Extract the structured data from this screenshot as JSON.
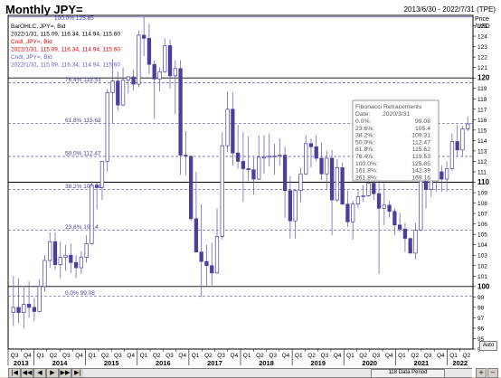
{
  "window": {
    "title": "Monthly JPY=",
    "date_range": "2013/6/30 - 2022/7/31 (TPE)"
  },
  "legend": {
    "top_label": "100.0% 125.85",
    "lines": [
      {
        "text": "BarOHLC, JPY=, Bid",
        "color": "#000000"
      },
      {
        "text": "2022/1/31, 115.09, 116.34, 114.94, 115.60",
        "color": "#000000"
      },
      {
        "text": "Cndl, JPY=, Bid",
        "color": "#e00000"
      },
      {
        "text": "2022/1/31, 115.09, 116.34, 114.94, 115.60",
        "color": "#e00000"
      },
      {
        "text": "Cndl, JPY=, Bid",
        "color": "#6a5acd"
      },
      {
        "text": "2022/1/31, 115.09, 116.34, 114.94, 115.60",
        "color": "#6a5acd"
      }
    ]
  },
  "fib_box": {
    "title": "Fibonacci Retracements",
    "date_label": "Date:",
    "date_value": "2020/3/31",
    "rows": [
      {
        "level": "0.0%:",
        "value": "99.08"
      },
      {
        "level": "23.6%:",
        "value": "105.4"
      },
      {
        "level": "38.2%:",
        "value": "109.31"
      },
      {
        "level": "50.0%:",
        "value": "112.47"
      },
      {
        "level": "61.8%:",
        "value": "115.62"
      },
      {
        "level": "76.4%:",
        "value": "119.53"
      },
      {
        "level": "100.0%:",
        "value": "125.85"
      },
      {
        "level": "161.8%:",
        "value": "142.39"
      },
      {
        "level": "261.8%:",
        "value": "169.16"
      }
    ]
  },
  "fib_labels": [
    {
      "text": "100.0%  125.85",
      "value": 125.85
    },
    {
      "text": "76.4%  119.53",
      "value": 119.53
    },
    {
      "text": "61.8%  115.62",
      "value": 115.62
    },
    {
      "text": "50.0%  112.47",
      "value": 112.47
    },
    {
      "text": "38.2%  109.31",
      "value": 109.31
    },
    {
      "text": "23.6%  105.4",
      "value": 105.4
    },
    {
      "text": "0.0%  99.08",
      "value": 99.08
    }
  ],
  "axis": {
    "price_label": "Price",
    "unit_label": "/USD",
    "auto_label": "Auto",
    "scroll_label": "118 Data Period"
  },
  "chart_data": {
    "type": "candlestick",
    "series_name": "JPY=, Bid",
    "ylim": [
      94,
      126
    ],
    "y_ticks": [
      94,
      95,
      96,
      97,
      98,
      99,
      100,
      101,
      102,
      103,
      104,
      105,
      106,
      107,
      108,
      109,
      110,
      111,
      112,
      113,
      114,
      115,
      116,
      117,
      118,
      119,
      120,
      121,
      122,
      123,
      124,
      125
    ],
    "y_bold_ticks": [
      100,
      110,
      120
    ],
    "x_quarter_labels": [
      "Q3",
      "Q4",
      "Q1",
      "Q2",
      "Q3",
      "Q4",
      "Q1",
      "Q2",
      "Q3",
      "Q4",
      "Q1",
      "Q2",
      "Q3",
      "Q4",
      "Q1",
      "Q2",
      "Q3",
      "Q4",
      "Q1",
      "Q2",
      "Q3",
      "Q4",
      "Q1",
      "Q2",
      "Q3",
      "Q4",
      "Q1",
      "Q2",
      "Q3",
      "Q4",
      "Q1",
      "Q2",
      "Q3",
      "Q4",
      "Q1",
      "Q2"
    ],
    "x_year_labels": [
      "2013",
      "2014",
      "2015",
      "2016",
      "2017",
      "2018",
      "2019",
      "2020",
      "2021",
      "2022"
    ],
    "year_quarter_index": [
      0,
      2,
      6,
      10,
      14,
      18,
      22,
      26,
      30,
      34
    ],
    "candles": [
      {
        "o": 97.5,
        "h": 101.0,
        "l": 96.2,
        "c": 98.0
      },
      {
        "o": 98.0,
        "h": 100.8,
        "l": 96.5,
        "c": 97.5
      },
      {
        "o": 97.5,
        "h": 99.9,
        "l": 96.0,
        "c": 98.3
      },
      {
        "o": 98.3,
        "h": 100.5,
        "l": 97.0,
        "c": 98.0
      },
      {
        "o": 98.0,
        "h": 98.9,
        "l": 96.7,
        "c": 97.6
      },
      {
        "o": 97.6,
        "h": 100.7,
        "l": 97.5,
        "c": 100.0
      },
      {
        "o": 100.0,
        "h": 103.0,
        "l": 99.5,
        "c": 102.5
      },
      {
        "o": 102.5,
        "h": 105.2,
        "l": 101.8,
        "c": 104.3
      },
      {
        "o": 104.3,
        "h": 105.2,
        "l": 101.6,
        "c": 102.1
      },
      {
        "o": 102.1,
        "h": 104.3,
        "l": 100.8,
        "c": 102.8
      },
      {
        "o": 102.8,
        "h": 104.0,
        "l": 101.5,
        "c": 103.0
      },
      {
        "o": 103.0,
        "h": 104.1,
        "l": 101.3,
        "c": 102.3
      },
      {
        "o": 102.3,
        "h": 103.0,
        "l": 100.8,
        "c": 101.8
      },
      {
        "o": 101.8,
        "h": 103.4,
        "l": 101.2,
        "c": 102.8
      },
      {
        "o": 102.8,
        "h": 104.9,
        "l": 102.3,
        "c": 104.1
      },
      {
        "o": 104.1,
        "h": 110.1,
        "l": 104.0,
        "c": 109.7
      },
      {
        "o": 109.7,
        "h": 110.0,
        "l": 107.4,
        "c": 109.5
      },
      {
        "o": 109.5,
        "h": 112.0,
        "l": 108.3,
        "c": 112.0
      },
      {
        "o": 112.0,
        "h": 118.9,
        "l": 111.0,
        "c": 118.6
      },
      {
        "o": 118.6,
        "h": 121.8,
        "l": 115.6,
        "c": 119.7
      },
      {
        "o": 119.7,
        "h": 120.6,
        "l": 116.9,
        "c": 117.4
      },
      {
        "o": 117.4,
        "h": 121.0,
        "l": 117.3,
        "c": 119.8
      },
      {
        "o": 119.8,
        "h": 120.2,
        "l": 118.5,
        "c": 120.1
      },
      {
        "o": 120.1,
        "h": 120.8,
        "l": 118.8,
        "c": 119.4
      },
      {
        "o": 119.4,
        "h": 124.5,
        "l": 119.1,
        "c": 124.1
      },
      {
        "o": 124.1,
        "h": 125.9,
        "l": 122.1,
        "c": 123.8
      },
      {
        "o": 123.8,
        "h": 125.2,
        "l": 120.4,
        "c": 121.3
      },
      {
        "o": 121.3,
        "h": 121.7,
        "l": 116.1,
        "c": 119.9
      },
      {
        "o": 119.9,
        "h": 121.0,
        "l": 118.7,
        "c": 120.6
      },
      {
        "o": 120.6,
        "h": 123.8,
        "l": 120.5,
        "c": 123.1
      },
      {
        "o": 123.1,
        "h": 123.7,
        "l": 119.0,
        "c": 120.2
      },
      {
        "o": 120.2,
        "h": 121.7,
        "l": 116.5,
        "c": 120.9
      },
      {
        "o": 120.9,
        "h": 121.7,
        "l": 110.7,
        "c": 112.6
      },
      {
        "o": 112.6,
        "h": 114.9,
        "l": 110.7,
        "c": 112.5
      },
      {
        "o": 112.5,
        "h": 111.9,
        "l": 106.3,
        "c": 106.5
      },
      {
        "o": 106.5,
        "h": 111.0,
        "l": 105.6,
        "c": 103.3
      },
      {
        "o": 103.3,
        "h": 107.9,
        "l": 99.0,
        "c": 102.4
      },
      {
        "o": 102.4,
        "h": 104.0,
        "l": 100.0,
        "c": 102.0
      },
      {
        "o": 102.0,
        "h": 104.2,
        "l": 100.1,
        "c": 101.3
      },
      {
        "o": 101.3,
        "h": 107.5,
        "l": 101.2,
        "c": 104.8
      },
      {
        "o": 104.8,
        "h": 114.8,
        "l": 104.5,
        "c": 113.5
      },
      {
        "o": 113.5,
        "h": 118.7,
        "l": 112.9,
        "c": 117.0
      },
      {
        "o": 117.0,
        "h": 118.6,
        "l": 111.6,
        "c": 112.8
      },
      {
        "o": 112.8,
        "h": 115.5,
        "l": 111.3,
        "c": 112.0
      },
      {
        "o": 112.0,
        "h": 114.8,
        "l": 108.1,
        "c": 111.3
      },
      {
        "o": 111.3,
        "h": 114.4,
        "l": 110.1,
        "c": 111.2
      },
      {
        "o": 111.2,
        "h": 112.4,
        "l": 108.8,
        "c": 110.3
      },
      {
        "o": 110.3,
        "h": 114.5,
        "l": 110.2,
        "c": 112.4
      },
      {
        "o": 112.4,
        "h": 114.5,
        "l": 110.8,
        "c": 112.4
      },
      {
        "o": 112.4,
        "h": 114.7,
        "l": 111.5,
        "c": 112.5
      },
      {
        "o": 112.5,
        "h": 113.7,
        "l": 110.7,
        "c": 112.5
      },
      {
        "o": 112.5,
        "h": 114.2,
        "l": 111.6,
        "c": 112.6
      },
      {
        "o": 112.6,
        "h": 113.4,
        "l": 106.6,
        "c": 109.2
      },
      {
        "o": 109.2,
        "h": 110.6,
        "l": 104.6,
        "c": 106.3
      },
      {
        "o": 106.3,
        "h": 109.3,
        "l": 104.6,
        "c": 109.2
      },
      {
        "o": 109.2,
        "h": 111.4,
        "l": 108.1,
        "c": 110.8
      },
      {
        "o": 110.8,
        "h": 114.5,
        "l": 110.7,
        "c": 113.7
      },
      {
        "o": 113.7,
        "h": 114.2,
        "l": 111.4,
        "c": 113.4
      },
      {
        "o": 113.4,
        "h": 114.5,
        "l": 112.0,
        "c": 112.3
      },
      {
        "o": 112.3,
        "h": 113.8,
        "l": 110.2,
        "c": 110.8
      },
      {
        "o": 110.8,
        "h": 113.0,
        "l": 109.3,
        "c": 112.3
      },
      {
        "o": 112.3,
        "h": 113.1,
        "l": 104.9,
        "c": 108.3
      },
      {
        "o": 108.3,
        "h": 112.2,
        "l": 108.1,
        "c": 111.4
      },
      {
        "o": 111.4,
        "h": 111.9,
        "l": 107.8,
        "c": 107.9
      },
      {
        "o": 107.9,
        "h": 109.2,
        "l": 105.7,
        "c": 106.2
      },
      {
        "o": 106.2,
        "h": 108.2,
        "l": 104.5,
        "c": 107.9
      },
      {
        "o": 107.9,
        "h": 109.3,
        "l": 107.5,
        "c": 108.6
      },
      {
        "o": 108.6,
        "h": 109.7,
        "l": 108.1,
        "c": 108.7
      },
      {
        "o": 108.7,
        "h": 111.1,
        "l": 108.6,
        "c": 109.9
      },
      {
        "o": 109.9,
        "h": 110.3,
        "l": 108.3,
        "c": 108.9
      },
      {
        "o": 108.9,
        "h": 112.2,
        "l": 101.2,
        "c": 107.5
      },
      {
        "o": 107.5,
        "h": 109.9,
        "l": 105.9,
        "c": 107.8
      },
      {
        "o": 107.8,
        "h": 108.2,
        "l": 106.6,
        "c": 107.2
      },
      {
        "o": 107.2,
        "h": 107.5,
        "l": 104.9,
        "c": 105.9
      },
      {
        "o": 105.9,
        "h": 107.1,
        "l": 105.2,
        "c": 105.5
      },
      {
        "o": 105.5,
        "h": 106.1,
        "l": 103.3,
        "c": 104.6
      },
      {
        "o": 104.6,
        "h": 104.7,
        "l": 103.2,
        "c": 103.2
      },
      {
        "o": 103.2,
        "h": 106.1,
        "l": 102.6,
        "c": 105.4
      },
      {
        "o": 105.4,
        "h": 110.9,
        "l": 105.3,
        "c": 110.7
      },
      {
        "o": 110.7,
        "h": 110.9,
        "l": 107.5,
        "c": 109.3
      },
      {
        "o": 109.3,
        "h": 110.3,
        "l": 108.6,
        "c": 110.3
      },
      {
        "o": 110.3,
        "h": 111.6,
        "l": 109.1,
        "c": 111.0
      },
      {
        "o": 111.0,
        "h": 111.6,
        "l": 109.1,
        "c": 110.3
      },
      {
        "o": 110.3,
        "h": 112.0,
        "l": 109.1,
        "c": 111.3
      },
      {
        "o": 111.3,
        "h": 114.7,
        "l": 111.1,
        "c": 113.9
      },
      {
        "o": 113.9,
        "h": 115.5,
        "l": 112.5,
        "c": 113.1
      },
      {
        "o": 113.1,
        "h": 115.4,
        "l": 112.5,
        "c": 115.1
      },
      {
        "o": 115.1,
        "h": 116.3,
        "l": 114.9,
        "c": 115.6
      }
    ]
  }
}
